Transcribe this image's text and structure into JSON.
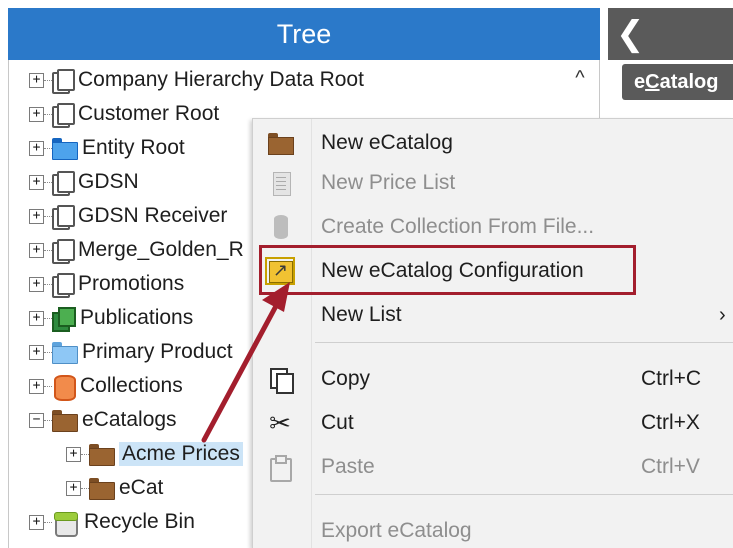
{
  "tree": {
    "title": "Tree",
    "scroll_up_glyph": "^",
    "items": [
      {
        "label": "Company Hierarchy Data Root",
        "expander": "+",
        "icon": "hierarchy-node-icon"
      },
      {
        "label": "Customer Root",
        "expander": "+",
        "icon": "hierarchy-node-icon"
      },
      {
        "label": "Entity Root",
        "expander": "+",
        "icon": "blue-folder-icon"
      },
      {
        "label": "GDSN",
        "expander": "+",
        "icon": "hierarchy-node-icon"
      },
      {
        "label": "GDSN Receiver",
        "expander": "+",
        "icon": "hierarchy-node-icon"
      },
      {
        "label": "Merge_Golden_R",
        "expander": "+",
        "icon": "hierarchy-node-icon"
      },
      {
        "label": "Promotions",
        "expander": "+",
        "icon": "hierarchy-node-icon"
      },
      {
        "label": "Publications",
        "expander": "+",
        "icon": "publications-icon"
      },
      {
        "label": "Primary Product",
        "expander": "+",
        "icon": "light-blue-folder-icon"
      },
      {
        "label": "Collections",
        "expander": "+",
        "icon": "collections-icon"
      },
      {
        "label": "eCatalogs",
        "expander": "−",
        "icon": "brown-folder-icon"
      },
      {
        "label": "Acme Prices",
        "expander": "+",
        "icon": "brown-folder-icon",
        "selected": true
      },
      {
        "label": "eCat",
        "expander": "+",
        "icon": "brown-folder-icon"
      },
      {
        "label": "Recycle Bin",
        "expander": "+",
        "icon": "recycle-bin-icon"
      }
    ]
  },
  "right_panel": {
    "back_glyph": "❮",
    "tab_prefix": "e",
    "tab_mnemonic": "C",
    "tab_rest": "atalog"
  },
  "context_menu": {
    "items": [
      {
        "label": "New eCatalog",
        "enabled": true,
        "icon": "folder-icon"
      },
      {
        "label": "New Price List",
        "enabled": false,
        "icon": "price-list-icon"
      },
      {
        "label": "Create Collection From File...",
        "enabled": false,
        "icon": "database-icon"
      },
      {
        "label": "New eCatalog Configuration",
        "enabled": true,
        "icon": "catalog-config-icon",
        "highlighted": true
      },
      {
        "label": "New List",
        "enabled": true,
        "submenu_glyph": "›"
      },
      {
        "label": "Copy",
        "enabled": true,
        "shortcut": "Ctrl+C",
        "icon": "copy-icon"
      },
      {
        "label": "Cut",
        "enabled": true,
        "shortcut": "Ctrl+X",
        "icon": "cut-icon"
      },
      {
        "label": "Paste",
        "enabled": false,
        "shortcut": "Ctrl+V",
        "icon": "paste-icon"
      },
      {
        "label": "Export eCatalog",
        "enabled": false
      }
    ]
  },
  "colors": {
    "tree_header": "#2b79c9",
    "right_header": "#5a5a5a",
    "menu_bg": "#f2f2f2",
    "annotation_red": "#a31e2d",
    "selection": "#cce4f7"
  }
}
